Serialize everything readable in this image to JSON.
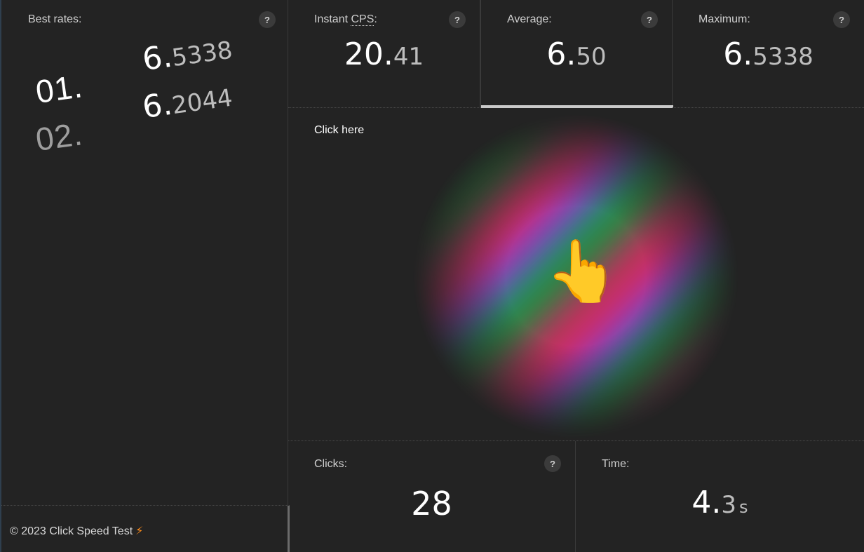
{
  "best": {
    "title": "Best rates:",
    "help": "?",
    "entries": [
      {
        "rank": "01.",
        "int": "6.",
        "dec": "5338"
      },
      {
        "rank": "02.",
        "int": "6.",
        "dec": "2044"
      }
    ]
  },
  "footer": {
    "text": "© 2023 Click Speed Test",
    "icon": "⚡"
  },
  "stats": {
    "instant": {
      "label_prefix": "Instant ",
      "label_abbr": "CPS",
      "label_suffix": ":",
      "int": "20.",
      "dec": "41",
      "help": "?"
    },
    "average": {
      "label": "Average:",
      "int": "6.",
      "dec": "50",
      "help": "?",
      "active": true
    },
    "maximum": {
      "label": "Maximum:",
      "int": "6.",
      "dec": "5338",
      "help": "?"
    }
  },
  "click_area": {
    "label": "Click here",
    "icon": "pointing-hand-icon",
    "hand": "👆"
  },
  "clicks": {
    "label": "Clicks:",
    "value": "28",
    "help": "?"
  },
  "time": {
    "label": "Time:",
    "int": "4.",
    "dec": "3",
    "unit": "s"
  },
  "colors": {
    "background": "#232323",
    "accent_bolt": "#ff8c1a",
    "active_bar": "#c9c9c9"
  }
}
